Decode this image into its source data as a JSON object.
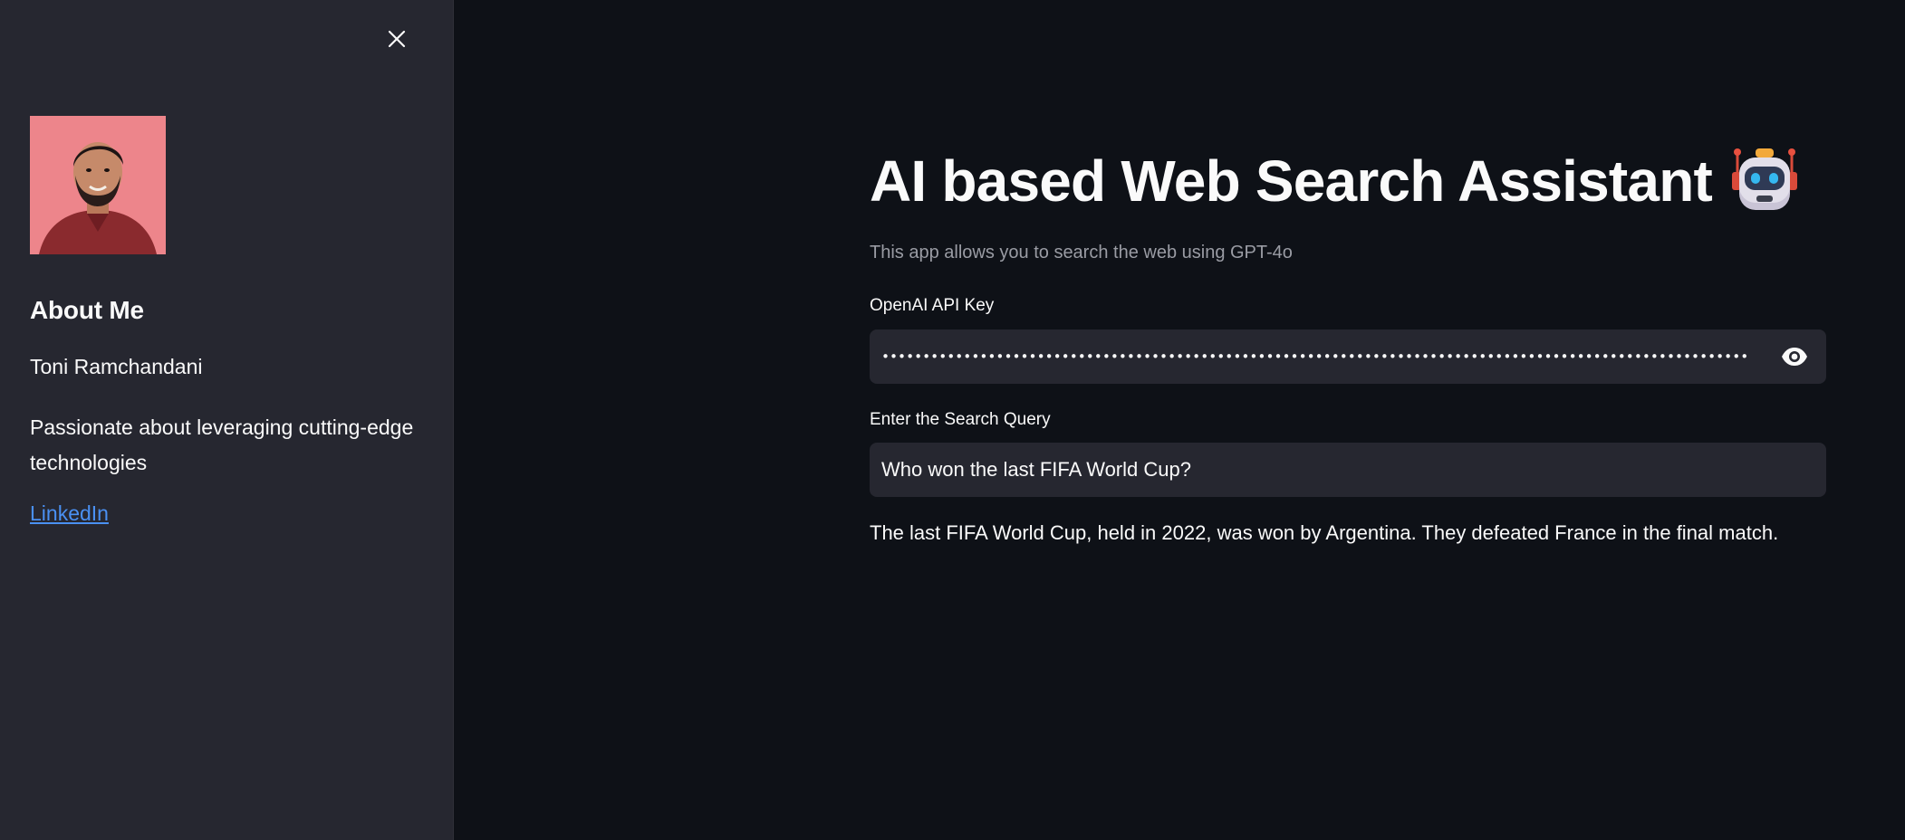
{
  "sidebar": {
    "close_icon": "close-icon",
    "avatar_alt": "profile-photo",
    "about_heading": "About Me",
    "name": "Toni Ramchandani",
    "description": "Passionate about leveraging cutting-edge technologies",
    "linkedin_label": "LinkedIn"
  },
  "main": {
    "title": "AI based Web Search Assistant",
    "title_icon": "robot-icon",
    "subtitle": "This app allows you to search the web using GPT-4o",
    "api_key": {
      "label": "OpenAI API Key",
      "masked_value": "••••••••••••••••••••••••••••••••••••••••••••••••••••••••••••••••••••••••••••••••••••••••••••••••••••••••••••••••••••••••••••••••••••••••••••••••••••••••••••••••••••••••••••••••••",
      "toggle_icon": "eye-icon"
    },
    "query": {
      "label": "Enter the Search Query",
      "value": "Who won the last FIFA World Cup?"
    },
    "answer": "The last FIFA World Cup, held in 2022, was won by Argentina. They defeated France in the final match."
  },
  "colors": {
    "background": "#0e1117",
    "sidebar": "#262730",
    "input": "#262730",
    "text": "#fafafa",
    "muted": "#9a9ca4",
    "link": "#4a90f2"
  }
}
